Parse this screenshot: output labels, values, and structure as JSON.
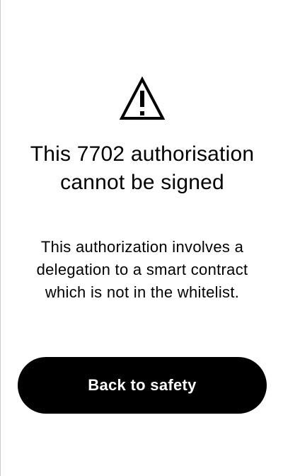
{
  "screen": {
    "warning_icon": "warning-triangle-icon",
    "title": "This 7702 authorisation cannot be signed",
    "message": "This authorization involves a delegation to a smart contract which is not in the whitelist.",
    "button_label": "Back to safety",
    "button_color": "#000000",
    "button_text_color": "#ffffff"
  }
}
